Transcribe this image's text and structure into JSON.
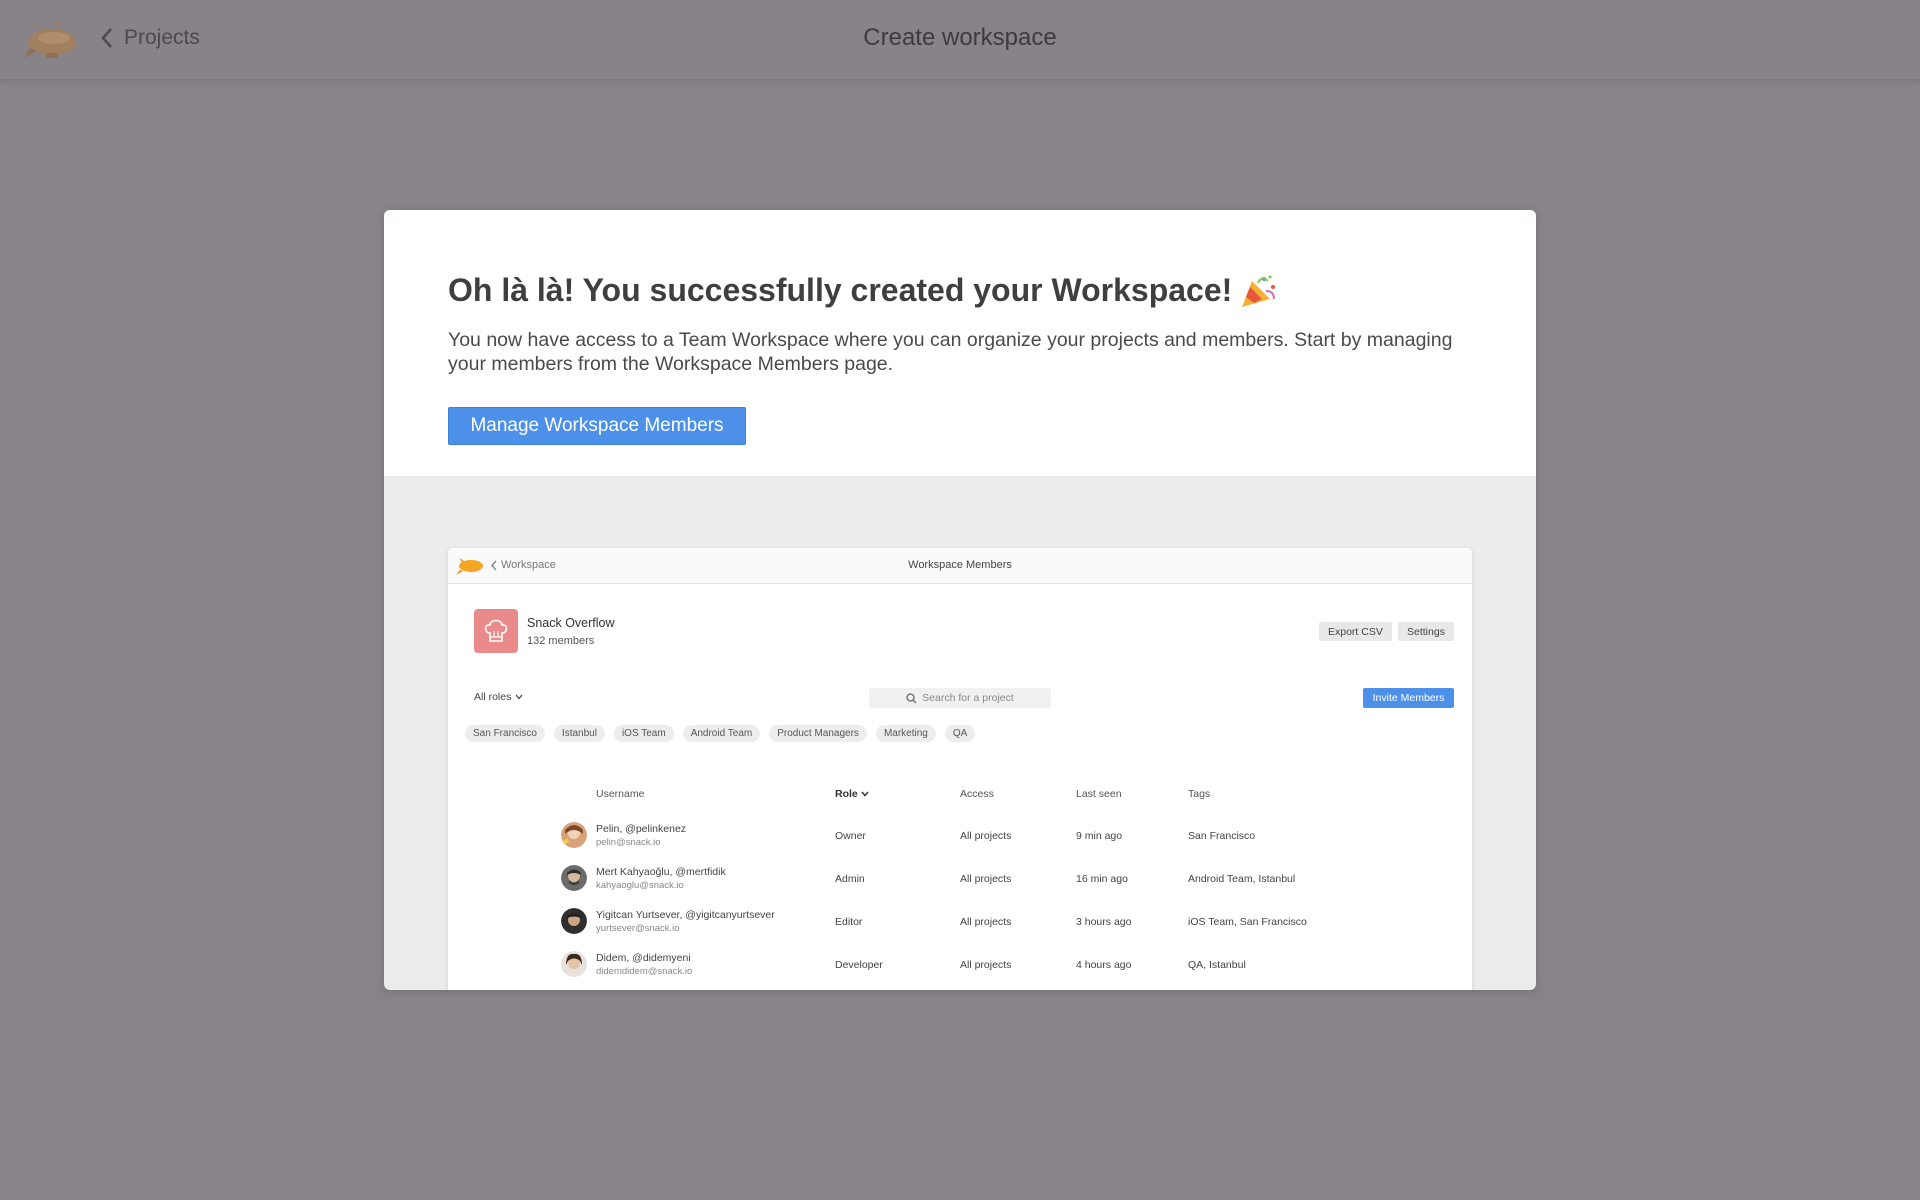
{
  "topbar": {
    "back_label": "Projects",
    "title": "Create workspace"
  },
  "modal": {
    "headline": "Oh là là! You successfully created your Workspace!",
    "description": "You now have access to a Team Workspace where you can organize your projects and members. Start by managing your members from the Workspace Members page.",
    "primary_button": "Manage Workspace Members"
  },
  "preview": {
    "back_label": "Workspace",
    "title": "Workspace Members",
    "org": {
      "name": "Snack Overflow",
      "members": "132 members"
    },
    "export_label": "Export CSV",
    "settings_label": "Settings",
    "roles_filter": "All roles",
    "search_placeholder": "Search for a project",
    "invite_label": "Invite Members",
    "tags": [
      "San Francisco",
      "Istanbul",
      "iOS Team",
      "Android Team",
      "Product Managers",
      "Marketing",
      "QA"
    ],
    "columns": {
      "username": "Username",
      "role": "Role",
      "access": "Access",
      "last_seen": "Last seen",
      "tags": "Tags"
    },
    "rows": [
      {
        "name": "Pelin, @pelinkenez",
        "email": "pelin@snack.io",
        "role": "Owner",
        "access": "All projects",
        "last_seen": "9 min ago",
        "tags": "San Francisco"
      },
      {
        "name": "Mert Kahyaoğlu, @mertfidik",
        "email": "kahyaoglu@snack.io",
        "role": "Admin",
        "access": "All projects",
        "last_seen": "16 min ago",
        "tags": "Android Team, Istanbul"
      },
      {
        "name": "Yigitcan Yurtsever, @yigitcanyurtsever",
        "email": "yurtsever@snack.io",
        "role": "Editor",
        "access": "All projects",
        "last_seen": "3 hours ago",
        "tags": "iOS Team, San Francisco"
      },
      {
        "name": "Didem, @didemyeni",
        "email": "didemdidem@snack.io",
        "role": "Developer",
        "access": "All projects",
        "last_seen": "4 hours ago",
        "tags": "QA, Istanbul"
      }
    ]
  },
  "colors": {
    "accent": "#4d90ea",
    "overlay": "#888489",
    "org_avatar": "#ea8a8a"
  }
}
